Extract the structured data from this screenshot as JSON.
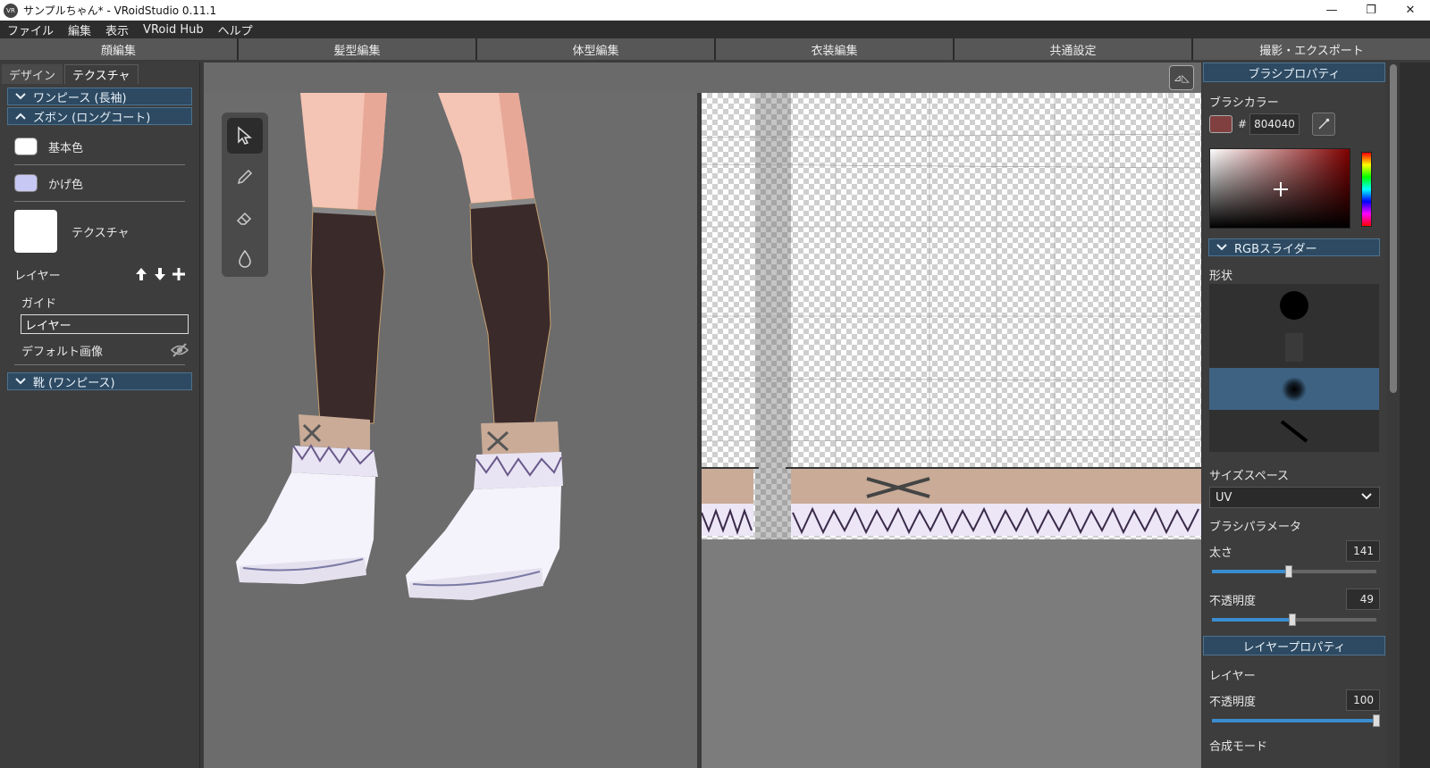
{
  "window": {
    "title": "サンプルちゃん* - VRoidStudio 0.11.1",
    "app_icon_text": "VR",
    "minimize": "—",
    "maximize": "❐",
    "close": "✕"
  },
  "menu": [
    "ファイル",
    "編集",
    "表示",
    "VRoid Hub",
    "ヘルプ"
  ],
  "main_tabs": [
    "顔編集",
    "髪型編集",
    "体型編集",
    "衣装編集",
    "共通設定",
    "撮影・エクスポート"
  ],
  "left": {
    "subtabs": [
      "デザイン",
      "テクスチャ"
    ],
    "sections": {
      "onepiece": "ワンピース (長袖)",
      "pants": "ズボン (ロングコート)",
      "shoes": "靴 (ワンピース)"
    },
    "base_color_label": "基本色",
    "shade_color_label": "かげ色",
    "texture_label": "テクスチャ",
    "layer_label": "レイヤー",
    "layers": {
      "guide": "ガイド",
      "layer_name": "レイヤー",
      "default_image": "デフォルト画像"
    },
    "colors": {
      "base": "#ffffff",
      "shade": "#c8c8f4"
    }
  },
  "viewport": {
    "mirror_label": "⊿◺"
  },
  "brush": {
    "header": "ブラシプロパティ",
    "color_label": "ブラシカラー",
    "hash": "#",
    "hex": "804040",
    "color": "#804040",
    "rgb_slider": "RGBスライダー",
    "shape_label": "形状",
    "size_space_label": "サイズスペース",
    "size_space_value": "UV",
    "params_label": "ブラシパラメータ",
    "thickness_label": "太さ",
    "thickness_value": "141",
    "thickness_fraction": 0.47,
    "opacity_label": "不透明度",
    "opacity_value": "49",
    "opacity_fraction": 0.49
  },
  "layer_props": {
    "header": "レイヤープロパティ",
    "layer_label": "レイヤー",
    "opacity_label": "不透明度",
    "opacity_value": "100",
    "opacity_fraction": 1.0,
    "blend_mode_label": "合成モード"
  }
}
